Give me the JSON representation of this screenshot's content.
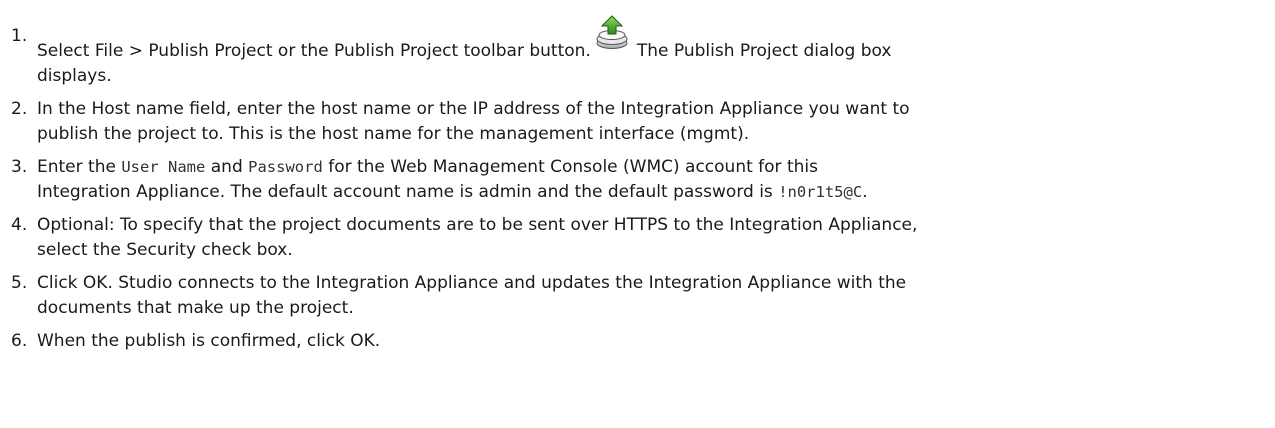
{
  "steps": [
    {
      "num": "1.",
      "a": "Select File > Publish Project or the Publish Project toolbar button.",
      "icon": "publish-project-icon",
      "b": "The Publish Project dialog box",
      "c": "displays."
    },
    {
      "num": "2.",
      "a": "In the Host name field, enter the host name or the IP address of the Integration Appliance you want to",
      "b": "publish the project to. This is the host name for the management interface (mgmt)."
    },
    {
      "num": "3.",
      "a": "Enter the",
      "code1": "User Name",
      "b": "and",
      "code2": "Password",
      "c": "for the Web Management Console (WMC) account for this",
      "d": "Integration Appliance. The default account name is admin and the default password is",
      "code3": "!n0r1t5@C",
      "e": "."
    },
    {
      "num": "4.",
      "a": "Optional: To specify that the project documents are to be sent over HTTPS to the Integration Appliance,",
      "b": "select the Security check box."
    },
    {
      "num": "5.",
      "a": "Click OK. Studio connects to the Integration Appliance and updates the Integration Appliance with the",
      "b": "documents that make up the project."
    },
    {
      "num": "6.",
      "a": "When the publish is confirmed, click OK."
    }
  ]
}
